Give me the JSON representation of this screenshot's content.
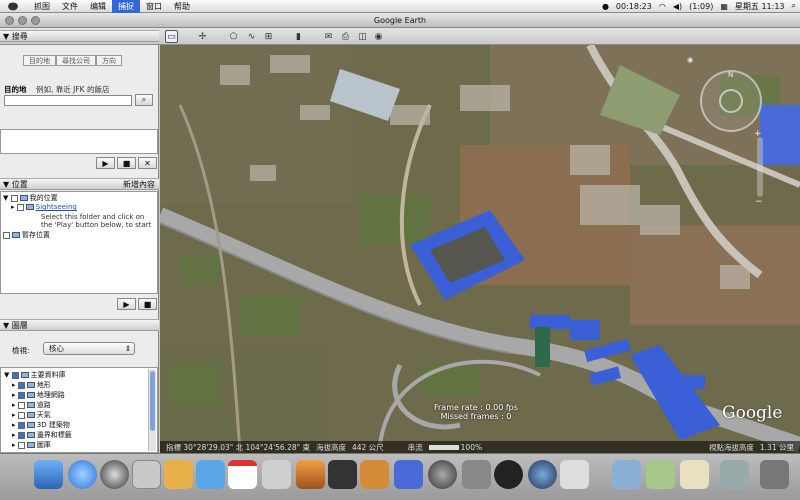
{
  "menubar": {
    "items": [
      "抓图",
      "文件",
      "编辑",
      "捕捉",
      "窗口",
      "帮助"
    ],
    "active_index": 3,
    "timer": "00:18:23",
    "battery": "(1:09)",
    "clock": "星期五 11:13"
  },
  "window": {
    "title": "Google Earth"
  },
  "search": {
    "header": "搜尋",
    "tabs": [
      "目的地",
      "尋找公司",
      "方向"
    ],
    "field_label": "目的地",
    "hint": "例如, 靠近 JFK 的飯店",
    "value": ""
  },
  "places": {
    "header": "位置",
    "add_label": "新增內容",
    "my_places": "我的位置",
    "sightseeing": "Sightseeing",
    "note": "Select this folder and click on the 'Play' button below, to start",
    "temp": "暫存位置"
  },
  "layers": {
    "header": "圖層",
    "view_label": "檢視:",
    "view_value": "核心",
    "items": [
      {
        "label": "主要資料庫",
        "checked": true
      },
      {
        "label": "地形",
        "checked": true
      },
      {
        "label": "地理網路",
        "checked": true
      },
      {
        "label": "道路",
        "checked": false
      },
      {
        "label": "天氣",
        "checked": false
      },
      {
        "label": "3D 建築物",
        "checked": true
      },
      {
        "label": "邊界和標籤",
        "checked": true
      },
      {
        "label": "圖庫",
        "checked": false
      }
    ]
  },
  "overlay": {
    "frame_rate": "Frame rate : 0.00 fps",
    "missed": "Missed frames : 0",
    "logo": "Google"
  },
  "status": {
    "pointer": "指標 30°28'29.03\" 北 104°24'56.28\" 東",
    "elevation_label": "海拔高度",
    "elevation": "442 公尺",
    "stream_label": "串流",
    "stream_value": "100%",
    "eye_label": "視點海拔高度",
    "eye_value": "1.31 公里"
  },
  "colors": {
    "accent": "#3467d6",
    "roof_blue": "#3a5fd6",
    "road": "#a8a8a8"
  }
}
